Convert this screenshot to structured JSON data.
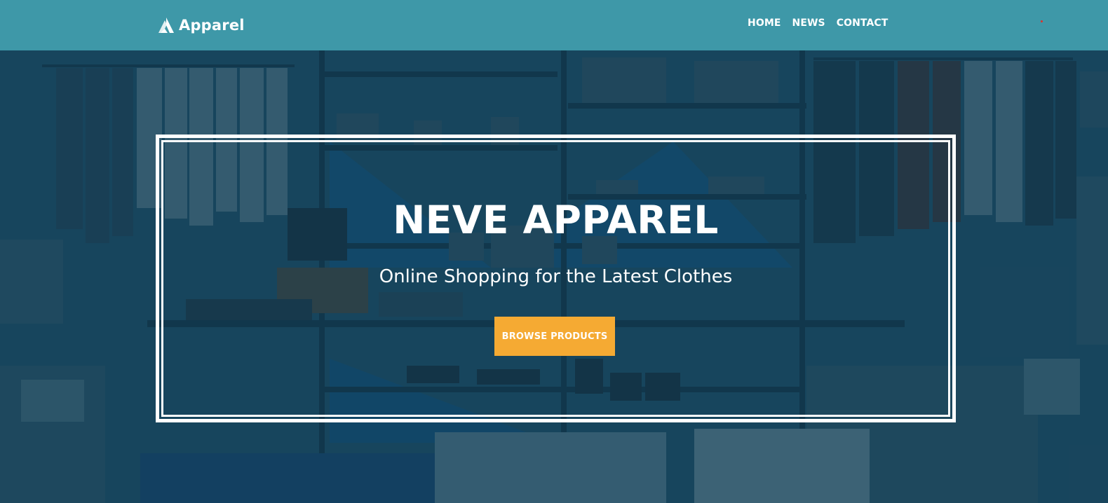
{
  "header": {
    "logo_text": "Apparel",
    "logo_icon": "apparel-logo-icon",
    "nav": [
      {
        "label": "HOME"
      },
      {
        "label": "NEWS"
      },
      {
        "label": "CONTACT"
      }
    ]
  },
  "hero": {
    "title": "NEVE APPAREL",
    "subtitle": "Online Shopping for the Latest Clothes",
    "button_label": "BROWSE PRODUCTS"
  },
  "colors": {
    "header_bg": "#3e98a8",
    "hero_tint": "#0d3b52",
    "button_bg": "#f5aa33",
    "text": "#ffffff"
  }
}
